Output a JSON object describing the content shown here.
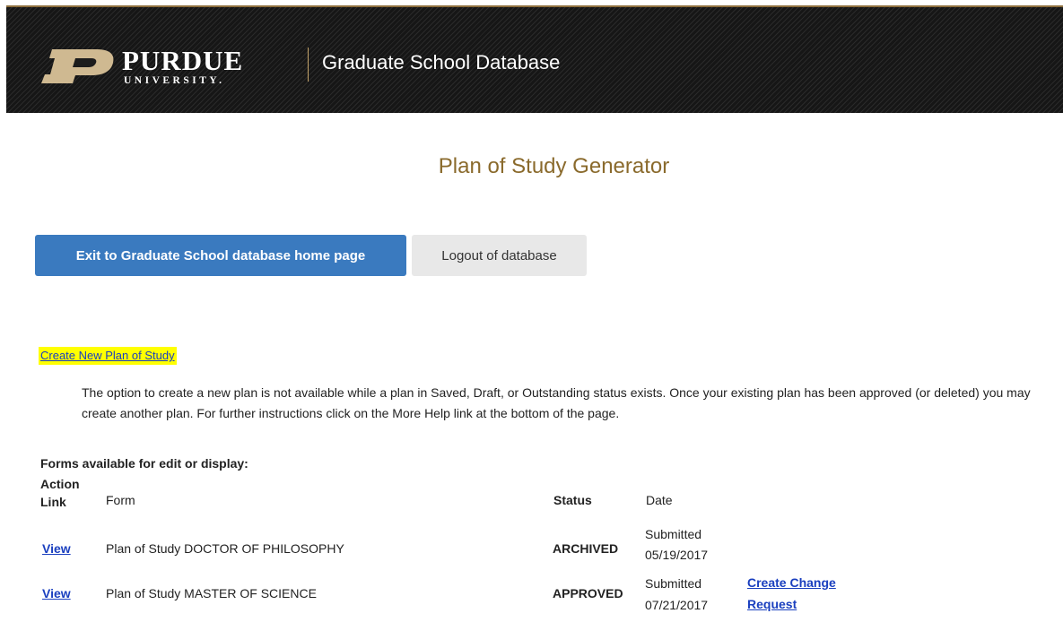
{
  "header": {
    "logo_word": "PURDUE",
    "logo_sub": "UNIVERSITY.",
    "title": "Graduate School Database"
  },
  "page_title": "Plan of Study Generator",
  "buttons": {
    "exit_label": "Exit to Graduate School database home page",
    "logout_label": "Logout of database"
  },
  "create_new_label": "Create New Plan of Study",
  "info_text": "The option to create a new plan is not available while a plan in Saved, Draft, or Outstanding status exists. Once your existing plan has been approved (or deleted) you may create another plan. For further instructions click on the More Help link at the bottom of the page.",
  "forms_label": "Forms available for edit or display:",
  "table": {
    "headers": {
      "action": "Action Link",
      "form": "Form",
      "status": "Status",
      "date": "Date"
    },
    "rows": [
      {
        "action": "View",
        "form": "Plan of Study DOCTOR OF PHILOSOPHY",
        "status": "ARCHIVED",
        "date_label": "Submitted",
        "date": "05/19/2017",
        "extra_link": ""
      },
      {
        "action": "View",
        "form": "Plan of Study MASTER OF SCIENCE",
        "status": "APPROVED",
        "date_label": "Submitted",
        "date": "07/21/2017",
        "extra_link_line1": "Create Change",
        "extra_link_line2": "Request"
      }
    ]
  },
  "colors": {
    "header_bg": "#1c1c1c",
    "gold": "#8a6a2c",
    "primary_button": "#3a7abf",
    "link": "#1a3fbf",
    "highlight": "#ffff00"
  }
}
